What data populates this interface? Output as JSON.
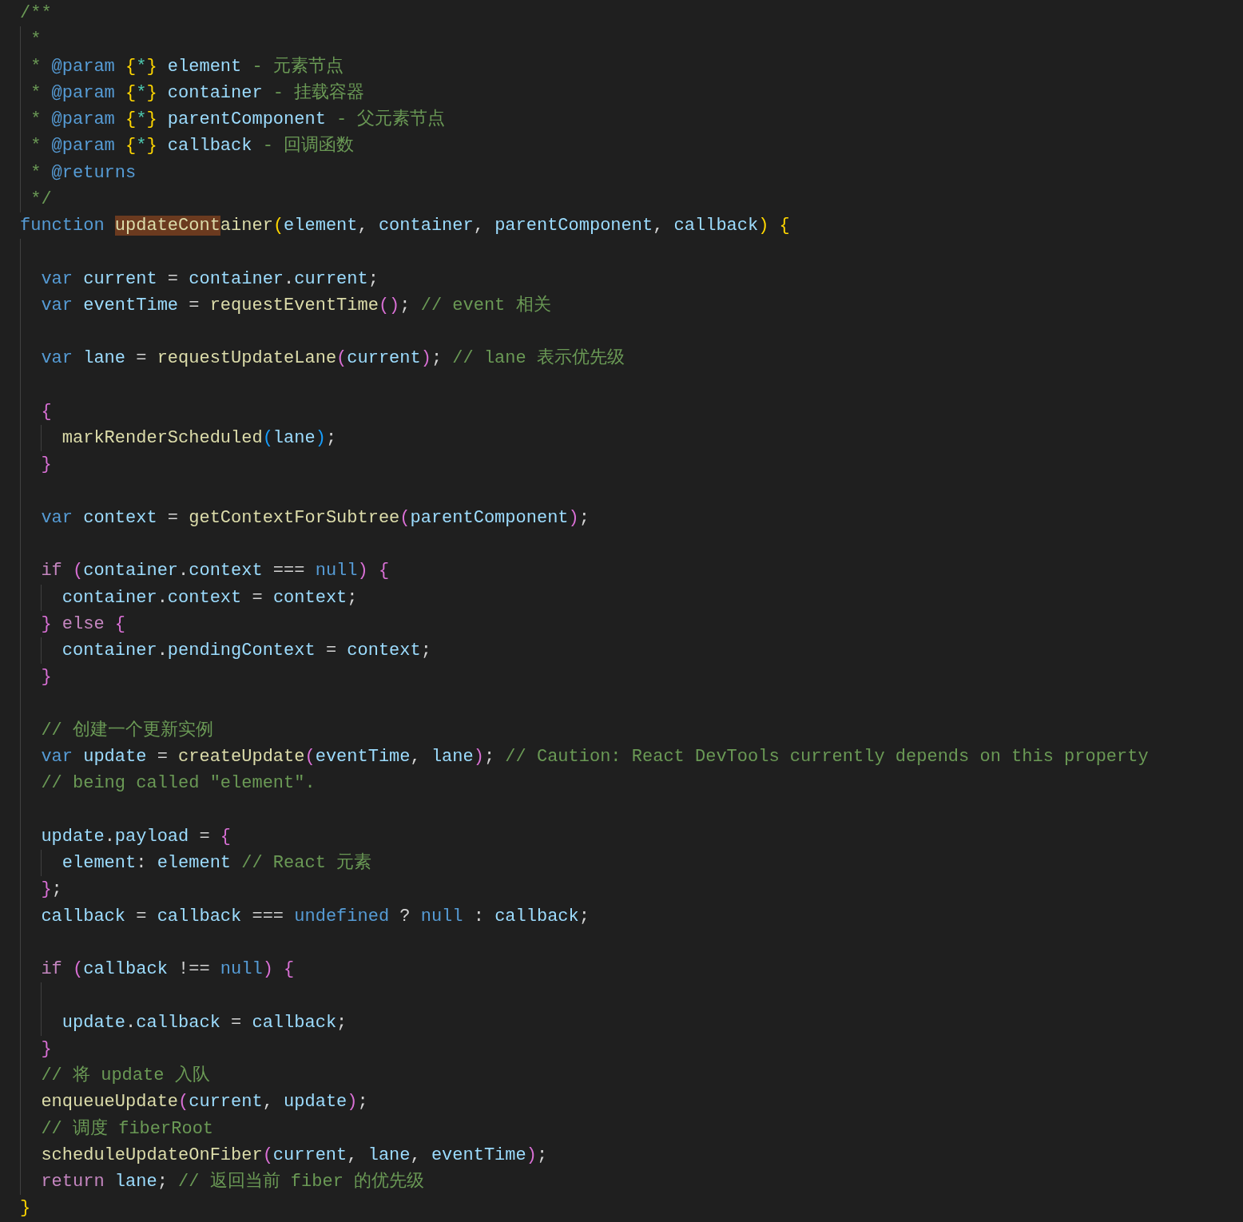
{
  "editor": {
    "lines": [
      {
        "kind": "code",
        "tokens": [
          {
            "text": "/**",
            "kind": "comment"
          }
        ]
      },
      {
        "kind": "code",
        "tokens": [
          {
            "text": " *",
            "kind": "comment"
          }
        ]
      },
      {
        "kind": "code",
        "tokens": [
          {
            "text": " * ",
            "kind": "comment"
          },
          {
            "text": "@param ",
            "kind": "tag"
          },
          {
            "text": "{",
            "kind": "bracket1"
          },
          {
            "text": "*",
            "kind": "type"
          },
          {
            "text": "}",
            "kind": "bracket1"
          },
          {
            "text": " element",
            "kind": "variable"
          },
          {
            "text": " - 元素节点",
            "kind": "comment"
          }
        ]
      },
      {
        "kind": "code",
        "tokens": [
          {
            "text": " * ",
            "kind": "comment"
          },
          {
            "text": "@param ",
            "kind": "tag"
          },
          {
            "text": "{",
            "kind": "bracket1"
          },
          {
            "text": "*",
            "kind": "type"
          },
          {
            "text": "}",
            "kind": "bracket1"
          },
          {
            "text": " container",
            "kind": "variable"
          },
          {
            "text": " - 挂载容器",
            "kind": "comment"
          }
        ]
      },
      {
        "kind": "code",
        "tokens": [
          {
            "text": " * ",
            "kind": "comment"
          },
          {
            "text": "@param ",
            "kind": "tag"
          },
          {
            "text": "{",
            "kind": "bracket1"
          },
          {
            "text": "*",
            "kind": "type"
          },
          {
            "text": "}",
            "kind": "bracket1"
          },
          {
            "text": " parentComponent",
            "kind": "variable"
          },
          {
            "text": " - 父元素节点",
            "kind": "comment"
          }
        ]
      },
      {
        "kind": "code",
        "tokens": [
          {
            "text": " * ",
            "kind": "comment"
          },
          {
            "text": "@param ",
            "kind": "tag"
          },
          {
            "text": "{",
            "kind": "bracket1"
          },
          {
            "text": "*",
            "kind": "type"
          },
          {
            "text": "}",
            "kind": "bracket1"
          },
          {
            "text": " callback",
            "kind": "variable"
          },
          {
            "text": " - 回调函数",
            "kind": "comment"
          }
        ]
      },
      {
        "kind": "code",
        "tokens": [
          {
            "text": " * ",
            "kind": "comment"
          },
          {
            "text": "@returns",
            "kind": "tag"
          }
        ]
      },
      {
        "kind": "code",
        "tokens": [
          {
            "text": " */",
            "kind": "comment"
          }
        ]
      },
      {
        "kind": "code",
        "tokens": [
          {
            "text": "function ",
            "kind": "keyword"
          },
          {
            "text": "updateCont",
            "kind": "function",
            "highlighted": true
          },
          {
            "text": "ainer",
            "kind": "function",
            "highlighted": false
          },
          {
            "text": "(",
            "kind": "bracket1"
          },
          {
            "text": "element",
            "kind": "variable"
          },
          {
            "text": ", ",
            "kind": "plain"
          },
          {
            "text": "container",
            "kind": "variable"
          },
          {
            "text": ", ",
            "kind": "plain"
          },
          {
            "text": "parentComponent",
            "kind": "variable"
          },
          {
            "text": ", ",
            "kind": "plain"
          },
          {
            "text": "callback",
            "kind": "variable"
          },
          {
            "text": ")",
            "kind": "bracket1"
          },
          {
            "text": " {",
            "kind": "bracket1"
          }
        ]
      },
      {
        "kind": "blank"
      },
      {
        "kind": "code",
        "tokens": [
          {
            "text": "  var",
            "kind": "keyword"
          },
          {
            "text": " current",
            "kind": "variable"
          },
          {
            "text": " = ",
            "kind": "plain"
          },
          {
            "text": "container",
            "kind": "variable"
          },
          {
            "text": ".",
            "kind": "plain"
          },
          {
            "text": "current",
            "kind": "variable"
          },
          {
            "text": ";",
            "kind": "plain"
          }
        ]
      },
      {
        "kind": "code",
        "tokens": [
          {
            "text": "  var",
            "kind": "keyword"
          },
          {
            "text": " eventTime",
            "kind": "variable"
          },
          {
            "text": " = ",
            "kind": "plain"
          },
          {
            "text": "requestEventTime",
            "kind": "function"
          },
          {
            "text": "()",
            "kind": "bracket2"
          },
          {
            "text": "; ",
            "kind": "plain"
          },
          {
            "text": "// event 相关",
            "kind": "comment"
          }
        ]
      },
      {
        "kind": "blank"
      },
      {
        "kind": "code",
        "tokens": [
          {
            "text": "  var",
            "kind": "keyword"
          },
          {
            "text": " lane",
            "kind": "variable"
          },
          {
            "text": " = ",
            "kind": "plain"
          },
          {
            "text": "requestUpdateLane",
            "kind": "function"
          },
          {
            "text": "(",
            "kind": "bracket2"
          },
          {
            "text": "current",
            "kind": "variable"
          },
          {
            "text": ")",
            "kind": "bracket2"
          },
          {
            "text": "; ",
            "kind": "plain"
          },
          {
            "text": "// lane 表示优先级",
            "kind": "comment"
          }
        ]
      },
      {
        "kind": "blank"
      },
      {
        "kind": "code",
        "tokens": [
          {
            "text": "  {",
            "kind": "bracket2"
          }
        ]
      },
      {
        "kind": "code",
        "tokens": [
          {
            "text": "    markRenderScheduled",
            "kind": "function"
          },
          {
            "text": "(",
            "kind": "bracket3"
          },
          {
            "text": "lane",
            "kind": "variable"
          },
          {
            "text": ")",
            "kind": "bracket3"
          },
          {
            "text": ";",
            "kind": "plain"
          }
        ]
      },
      {
        "kind": "code",
        "tokens": [
          {
            "text": "  }",
            "kind": "bracket2"
          }
        ]
      },
      {
        "kind": "blank"
      },
      {
        "kind": "code",
        "tokens": [
          {
            "text": "  var",
            "kind": "keyword"
          },
          {
            "text": " context",
            "kind": "variable"
          },
          {
            "text": " = ",
            "kind": "plain"
          },
          {
            "text": "getContextForSubtree",
            "kind": "function"
          },
          {
            "text": "(",
            "kind": "bracket2"
          },
          {
            "text": "parentComponent",
            "kind": "variable"
          },
          {
            "text": ")",
            "kind": "bracket2"
          },
          {
            "text": ";",
            "kind": "plain"
          }
        ]
      },
      {
        "kind": "blank"
      },
      {
        "kind": "code",
        "tokens": [
          {
            "text": "  if ",
            "kind": "control"
          },
          {
            "text": "(",
            "kind": "bracket2"
          },
          {
            "text": "container",
            "kind": "variable"
          },
          {
            "text": ".",
            "kind": "plain"
          },
          {
            "text": "context",
            "kind": "variable"
          },
          {
            "text": " === ",
            "kind": "plain"
          },
          {
            "text": "null",
            "kind": "constant"
          },
          {
            "text": ")",
            "kind": "bracket2"
          },
          {
            "text": " {",
            "kind": "bracket2"
          }
        ]
      },
      {
        "kind": "code",
        "tokens": [
          {
            "text": "    container",
            "kind": "variable"
          },
          {
            "text": ".",
            "kind": "plain"
          },
          {
            "text": "context",
            "kind": "variable"
          },
          {
            "text": " = ",
            "kind": "plain"
          },
          {
            "text": "context",
            "kind": "variable"
          },
          {
            "text": ";",
            "kind": "plain"
          }
        ]
      },
      {
        "kind": "code",
        "tokens": [
          {
            "text": "  }",
            "kind": "bracket2"
          },
          {
            "text": " else",
            "kind": "control"
          },
          {
            "text": " {",
            "kind": "bracket2"
          }
        ]
      },
      {
        "kind": "code",
        "tokens": [
          {
            "text": "    container",
            "kind": "variable"
          },
          {
            "text": ".",
            "kind": "plain"
          },
          {
            "text": "pendingContext",
            "kind": "variable"
          },
          {
            "text": " = ",
            "kind": "plain"
          },
          {
            "text": "context",
            "kind": "variable"
          },
          {
            "text": ";",
            "kind": "plain"
          }
        ]
      },
      {
        "kind": "code",
        "tokens": [
          {
            "text": "  }",
            "kind": "bracket2"
          }
        ]
      },
      {
        "kind": "blank"
      },
      {
        "kind": "code",
        "tokens": [
          {
            "text": "  // 创建一个更新实例",
            "kind": "comment"
          }
        ]
      },
      {
        "kind": "code",
        "tokens": [
          {
            "text": "  var",
            "kind": "keyword"
          },
          {
            "text": " update",
            "kind": "variable"
          },
          {
            "text": " = ",
            "kind": "plain"
          },
          {
            "text": "createUpdate",
            "kind": "function"
          },
          {
            "text": "(",
            "kind": "bracket2"
          },
          {
            "text": "eventTime",
            "kind": "variable"
          },
          {
            "text": ", ",
            "kind": "plain"
          },
          {
            "text": "lane",
            "kind": "variable"
          },
          {
            "text": ")",
            "kind": "bracket2"
          },
          {
            "text": "; ",
            "kind": "plain"
          },
          {
            "text": "// Caution: React DevTools currently depends on this property",
            "kind": "comment"
          }
        ]
      },
      {
        "kind": "code",
        "tokens": [
          {
            "text": "  // being called \"element\".",
            "kind": "comment"
          }
        ]
      },
      {
        "kind": "blank"
      },
      {
        "kind": "code",
        "tokens": [
          {
            "text": "  update",
            "kind": "variable"
          },
          {
            "text": ".",
            "kind": "plain"
          },
          {
            "text": "payload",
            "kind": "variable"
          },
          {
            "text": " = ",
            "kind": "plain"
          },
          {
            "text": "{",
            "kind": "bracket2"
          }
        ]
      },
      {
        "kind": "code",
        "tokens": [
          {
            "text": "    element",
            "kind": "variable"
          },
          {
            "text": ": ",
            "kind": "plain"
          },
          {
            "text": "element",
            "kind": "variable"
          },
          {
            "text": " // React 元素",
            "kind": "comment"
          }
        ]
      },
      {
        "kind": "code",
        "tokens": [
          {
            "text": "  }",
            "kind": "bracket2"
          },
          {
            "text": ";",
            "kind": "plain"
          }
        ]
      },
      {
        "kind": "code",
        "tokens": [
          {
            "text": "  callback",
            "kind": "variable"
          },
          {
            "text": " = ",
            "kind": "plain"
          },
          {
            "text": "callback",
            "kind": "variable"
          },
          {
            "text": " === ",
            "kind": "plain"
          },
          {
            "text": "undefined",
            "kind": "constant"
          },
          {
            "text": " ? ",
            "kind": "plain"
          },
          {
            "text": "null",
            "kind": "constant"
          },
          {
            "text": " : ",
            "kind": "plain"
          },
          {
            "text": "callback",
            "kind": "variable"
          },
          {
            "text": ";",
            "kind": "plain"
          }
        ]
      },
      {
        "kind": "blank"
      },
      {
        "kind": "code",
        "tokens": [
          {
            "text": "  if ",
            "kind": "control"
          },
          {
            "text": "(",
            "kind": "bracket2"
          },
          {
            "text": "callback",
            "kind": "variable"
          },
          {
            "text": " !== ",
            "kind": "plain"
          },
          {
            "text": "null",
            "kind": "constant"
          },
          {
            "text": ")",
            "kind": "bracket2"
          },
          {
            "text": " {",
            "kind": "bracket2"
          }
        ]
      },
      {
        "kind": "blank"
      },
      {
        "kind": "code",
        "tokens": [
          {
            "text": "    update",
            "kind": "variable"
          },
          {
            "text": ".",
            "kind": "plain"
          },
          {
            "text": "callback",
            "kind": "variable"
          },
          {
            "text": " = ",
            "kind": "plain"
          },
          {
            "text": "callback",
            "kind": "variable"
          },
          {
            "text": ";",
            "kind": "plain"
          }
        ]
      },
      {
        "kind": "code",
        "tokens": [
          {
            "text": "  }",
            "kind": "bracket2"
          }
        ]
      },
      {
        "kind": "code",
        "tokens": [
          {
            "text": "  // 将 update 入队",
            "kind": "comment"
          }
        ]
      },
      {
        "kind": "code",
        "tokens": [
          {
            "text": "  enqueueUpdate",
            "kind": "function"
          },
          {
            "text": "(",
            "kind": "bracket2"
          },
          {
            "text": "current",
            "kind": "variable"
          },
          {
            "text": ", ",
            "kind": "plain"
          },
          {
            "text": "update",
            "kind": "variable"
          },
          {
            "text": ")",
            "kind": "bracket2"
          },
          {
            "text": ";",
            "kind": "plain"
          }
        ]
      },
      {
        "kind": "code",
        "tokens": [
          {
            "text": "  // 调度 fiberRoot",
            "kind": "comment"
          }
        ]
      },
      {
        "kind": "code",
        "tokens": [
          {
            "text": "  scheduleUpdateOnFiber",
            "kind": "function"
          },
          {
            "text": "(",
            "kind": "bracket2"
          },
          {
            "text": "current",
            "kind": "variable"
          },
          {
            "text": ", ",
            "kind": "plain"
          },
          {
            "text": "lane",
            "kind": "variable"
          },
          {
            "text": ", ",
            "kind": "plain"
          },
          {
            "text": "eventTime",
            "kind": "variable"
          },
          {
            "text": ")",
            "kind": "bracket2"
          },
          {
            "text": ";",
            "kind": "plain"
          }
        ]
      },
      {
        "kind": "code",
        "tokens": [
          {
            "text": "  return",
            "kind": "control"
          },
          {
            "text": " lane",
            "kind": "variable"
          },
          {
            "text": "; ",
            "kind": "plain"
          },
          {
            "text": "// 返回当前 fiber 的优先级",
            "kind": "comment"
          }
        ]
      },
      {
        "kind": "code",
        "tokens": [
          {
            "text": "}",
            "kind": "bracket1"
          }
        ]
      }
    ]
  }
}
